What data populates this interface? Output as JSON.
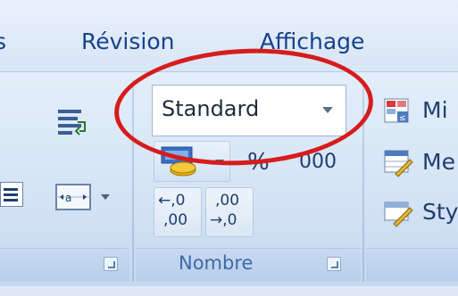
{
  "tabs": [
    {
      "label": "s"
    },
    {
      "label": "Révision"
    },
    {
      "label": "Affichage"
    }
  ],
  "groups": {
    "number": {
      "label": "Nombre",
      "format_dropdown": {
        "value": "Standard"
      },
      "percent_label": "%",
      "thousands_label": "000",
      "increase_decimal": {
        "top": "←,0",
        "bottom": ",00"
      },
      "decrease_decimal": {
        "top": ",00",
        "bottom": "→,0"
      }
    },
    "styles": {
      "conditional_format_label": "Mi",
      "format_table_label": "Me",
      "cell_styles_label": "Sty"
    }
  },
  "annotation": {
    "color": "#d61c1c"
  },
  "colors": {
    "tab_text": "#15428b",
    "ribbon_bg": "#d4e3f4",
    "group_label": "#3e6aaa"
  }
}
